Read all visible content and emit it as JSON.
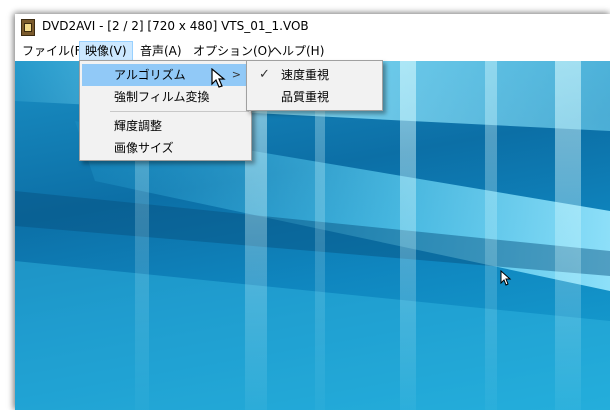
{
  "window": {
    "title": "DVD2AVI - [2 / 2] [720 x 480] VTS_01_1.VOB"
  },
  "menubar": {
    "items": [
      {
        "label": "ファイル(F)"
      },
      {
        "label": "映像(V)"
      },
      {
        "label": "音声(A)"
      },
      {
        "label": "オプション(O)"
      },
      {
        "label": "ヘルプ(H)"
      }
    ]
  },
  "video_menu": {
    "items": [
      {
        "label": "アルゴリズム"
      },
      {
        "label": "強制フィルム変換"
      },
      {
        "label": "輝度調整"
      },
      {
        "label": "画像サイズ"
      }
    ]
  },
  "algorithm_submenu": {
    "items": [
      {
        "label": "速度重視",
        "checked": true
      },
      {
        "label": "品質重視",
        "checked": false
      }
    ]
  },
  "icons": {
    "app": "film-icon",
    "arrow": "chevron-right-icon",
    "check": "check-icon",
    "cursor": "pointer-hand-icon"
  },
  "colors": {
    "menu_highlight": "#91c9f7",
    "menubar_active": "#cce8ff",
    "video_background": "#0c6fa6"
  }
}
